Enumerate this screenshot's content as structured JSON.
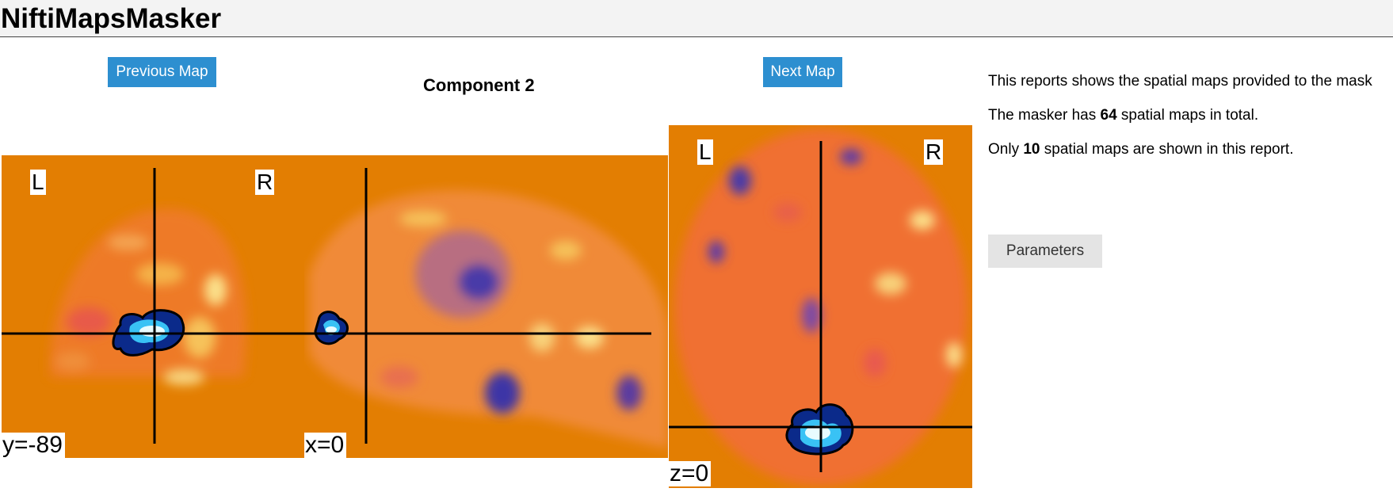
{
  "header": {
    "title": "NiftiMapsMasker"
  },
  "navigation": {
    "previous_label": "Previous Map",
    "next_label": "Next Map"
  },
  "component": {
    "title": "Component 2"
  },
  "views": {
    "coronal": {
      "left_label": "L",
      "right_label": "R",
      "coord": "y=-89"
    },
    "sagittal": {
      "coord": "x=0"
    },
    "axial": {
      "left_label": "L",
      "right_label": "R",
      "coord": "z=0"
    }
  },
  "info": {
    "line1": "This reports shows the spatial maps provided to the mask",
    "line2_pre": "The masker has ",
    "line2_num": "64",
    "line2_post": " spatial maps in total.",
    "line3_pre": "Only ",
    "line3_num": "10",
    "line3_post": " spatial maps are shown in this report."
  },
  "parameters": {
    "label": "Parameters"
  },
  "colors": {
    "background_map": "#e37e02",
    "nav_button": "#2d8fd0",
    "activation": "#29b6f6",
    "cursor": "#000000"
  }
}
